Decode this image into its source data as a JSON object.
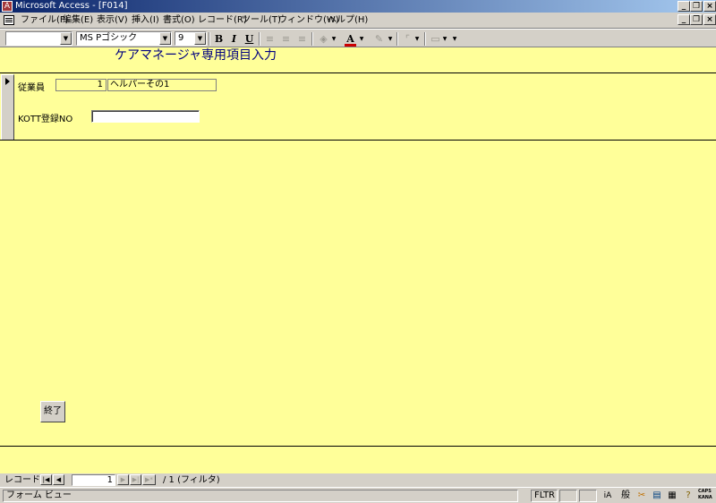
{
  "window": {
    "title": "Microsoft Access - [F014]",
    "app_icon_letter": "A",
    "controls": [
      "_",
      "❐",
      "×"
    ]
  },
  "menubar": {
    "items": [
      "ファイル(F)",
      "編集(E)",
      "表示(V)",
      "挿入(I)",
      "書式(O)",
      "レコード(R)",
      "ツール(T)",
      "ウィンドウ(W)",
      "ヘルプ(H)"
    ],
    "doc_controls": [
      "_",
      "❐",
      "×"
    ]
  },
  "toolbar": {
    "object_combo": "",
    "font_name": "MS Pゴシック",
    "font_size": "9",
    "bold": "B",
    "italic": "I",
    "underline": "U",
    "font_color_glyph": "A",
    "accent_color": "#cc0000"
  },
  "form": {
    "background": "#ffff99",
    "title": "ケアマネージャ専用項目入力",
    "employee_label": "従業員",
    "employee_id": "1",
    "employee_name": "ヘルパーその1",
    "kott_label": "KOTT登録NO",
    "kott_value": "",
    "exit_button": "終了"
  },
  "navbar": {
    "label": "レコード:",
    "current": "1",
    "total_text": "/ 1 (フィルタ)",
    "buttons": [
      "|◀",
      "◀",
      "▶",
      "▶|",
      "▶*"
    ]
  },
  "statusbar": {
    "text": "フォーム ビュー",
    "filter": "FLTR",
    "ime_mode": "般",
    "caps": "CAPS",
    "kana": "KANA"
  }
}
